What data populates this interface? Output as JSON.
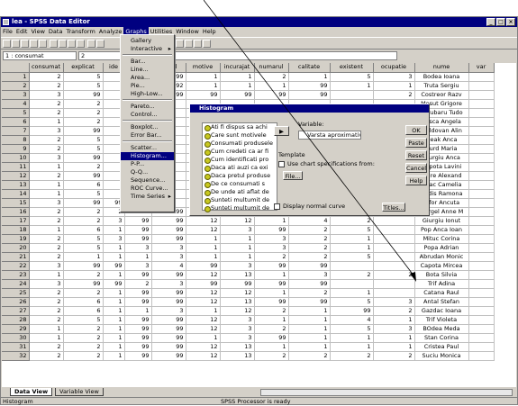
{
  "title": "lea - SPSS Data Editor",
  "window_buttons": [
    "_",
    "□",
    "×"
  ],
  "menus": [
    "File",
    "Edit",
    "View",
    "Data",
    "Transform",
    "Analyze",
    "Graphs",
    "Utilities",
    "Window",
    "Help"
  ],
  "active_menu": "Graphs",
  "cell_ref": "1 : consumat",
  "cell_value": "2",
  "columns": [
    "consumat",
    "explicat",
    "ide",
    "",
    "pretul",
    "motive",
    "incurajat",
    "numarul",
    "calitate",
    "existent",
    "ocupatie",
    "nume",
    "var"
  ],
  "rows": [
    [
      "2",
      "5",
      "",
      "",
      "99",
      "1",
      "1",
      "2",
      "1",
      "5",
      "3",
      "Bodea Ioana"
    ],
    [
      "2",
      "5",
      "",
      "",
      "992",
      "1",
      "1",
      "1",
      "99",
      "1",
      "1",
      "Truta Sergiu"
    ],
    [
      "3",
      "99",
      "",
      "",
      "99",
      "99",
      "99",
      "99",
      "99",
      "",
      "2",
      "Costreor Razv"
    ],
    [
      "2",
      "2",
      "",
      "",
      "",
      "",
      "",
      "",
      "",
      "",
      "",
      "Mosut Grigore"
    ],
    [
      "2",
      "2",
      "",
      "",
      "",
      "",
      "",
      "",
      "",
      "",
      "",
      "Surubaru Tudo"
    ],
    [
      "1",
      "2",
      "",
      "",
      "",
      "",
      "",
      "",
      "",
      "",
      "",
      "Rosca Angela"
    ],
    [
      "3",
      "99",
      "",
      "",
      "",
      "",
      "",
      "",
      "",
      "",
      "",
      "Moldovan Alin"
    ],
    [
      "2",
      "5",
      "",
      "",
      "",
      "",
      "",
      "",
      "",
      "",
      "",
      "Deak Anca"
    ],
    [
      "2",
      "5",
      "",
      "",
      "",
      "",
      "",
      "",
      "",
      "",
      "",
      "Surd Maria"
    ],
    [
      "3",
      "99",
      "",
      "",
      "",
      "",
      "",
      "",
      "",
      "",
      "",
      "Giurgiu Anca"
    ],
    [
      "1",
      "2",
      "",
      "",
      "",
      "",
      "",
      "",
      "",
      "",
      "",
      "Capota Lavini"
    ],
    [
      "2",
      "99",
      "",
      "",
      "",
      "",
      "",
      "",
      "",
      "",
      "",
      "Indre Alexand"
    ],
    [
      "1",
      "6",
      "",
      "",
      "",
      "",
      "",
      "",
      "",
      "",
      "",
      "Deac Camelia"
    ],
    [
      "1",
      "5",
      "",
      "",
      "",
      "",
      "",
      "",
      "",
      "",
      "",
      "Hodis Ramona"
    ],
    [
      "3",
      "99",
      "99",
      "3",
      "",
      "",
      "",
      "",
      "",
      "",
      "",
      "Cifor Ancuta"
    ],
    [
      "2",
      "2",
      "2",
      "99",
      "99",
      "1",
      "2",
      "1",
      "6",
      "3",
      "",
      "Mergel Anne M"
    ],
    [
      "2",
      "2",
      "3",
      "99",
      "99",
      "12",
      "12",
      "1",
      "4",
      "2",
      "",
      "Giurgiu Ionut"
    ],
    [
      "1",
      "6",
      "1",
      "99",
      "99",
      "12",
      "3",
      "99",
      "2",
      "5",
      "",
      "Pop Anca Ioan"
    ],
    [
      "2",
      "5",
      "3",
      "99",
      "99",
      "1",
      "1",
      "3",
      "2",
      "1",
      "",
      "Mituc Corina"
    ],
    [
      "2",
      "5",
      "1",
      "3",
      "3",
      "1",
      "1",
      "3",
      "2",
      "1",
      "",
      "Popa Adrian"
    ],
    [
      "2",
      "1",
      "1",
      "1",
      "3",
      "1",
      "1",
      "2",
      "2",
      "5",
      "",
      "Abrudan Monic"
    ],
    [
      "3",
      "99",
      "99",
      "3",
      "4",
      "99",
      "3",
      "99",
      "99",
      "",
      "",
      "Capota Mircea"
    ],
    [
      "1",
      "2",
      "1",
      "99",
      "99",
      "12",
      "13",
      "1",
      "3",
      "2",
      "2",
      "Bota Silvia"
    ],
    [
      "3",
      "99",
      "99",
      "2",
      "3",
      "99",
      "99",
      "99",
      "99",
      "",
      "",
      "Trif Adina"
    ],
    [
      "2",
      "2",
      "1",
      "99",
      "99",
      "12",
      "12",
      "1",
      "2",
      "1",
      "",
      "Catana Raul"
    ],
    [
      "2",
      "6",
      "1",
      "99",
      "99",
      "12",
      "13",
      "99",
      "99",
      "5",
      "3",
      "Antal Stefan"
    ],
    [
      "2",
      "6",
      "1",
      "1",
      "3",
      "1",
      "12",
      "2",
      "1",
      "99",
      "2",
      "Gazdac Ioana"
    ],
    [
      "2",
      "5",
      "1",
      "99",
      "99",
      "12",
      "3",
      "1",
      "1",
      "4",
      "1",
      "Trif Violeta"
    ],
    [
      "1",
      "2",
      "1",
      "99",
      "99",
      "12",
      "3",
      "2",
      "1",
      "5",
      "3",
      "BOdea Meda"
    ],
    [
      "1",
      "2",
      "1",
      "99",
      "99",
      "1",
      "3",
      "99",
      "1",
      "1",
      "1",
      "Stan Corina"
    ],
    [
      "2",
      "2",
      "1",
      "99",
      "99",
      "12",
      "13",
      "1",
      "1",
      "1",
      "1",
      "Cristea Paul"
    ],
    [
      "2",
      "2",
      "1",
      "99",
      "99",
      "12",
      "13",
      "2",
      "2",
      "2",
      "2",
      "Suciu Monica"
    ]
  ],
  "graphs_menu": {
    "items": [
      {
        "label": "Gallery",
        "sub": false
      },
      {
        "label": "Interactive",
        "sub": true
      },
      {
        "sep": true
      },
      {
        "label": "Bar...",
        "sub": false
      },
      {
        "label": "Line...",
        "sub": false
      },
      {
        "label": "Area...",
        "sub": false
      },
      {
        "label": "Pie...",
        "sub": false
      },
      {
        "label": "High-Low...",
        "sub": false
      },
      {
        "sep": true
      },
      {
        "label": "Pareto...",
        "sub": false
      },
      {
        "label": "Control...",
        "sub": false
      },
      {
        "sep": true
      },
      {
        "label": "Boxplot...",
        "sub": false
      },
      {
        "label": "Error Bar...",
        "sub": false
      },
      {
        "sep": true
      },
      {
        "label": "Scatter...",
        "sub": false
      },
      {
        "label": "Histogram...",
        "sub": false,
        "highlighted": true
      },
      {
        "label": "P-P...",
        "sub": false
      },
      {
        "label": "Q-Q...",
        "sub": false
      },
      {
        "label": "Sequence...",
        "sub": false
      },
      {
        "label": "ROC Curve...",
        "sub": false
      },
      {
        "label": "Time Series",
        "sub": true
      }
    ]
  },
  "dialog": {
    "title": "Histogram",
    "variables": [
      "Ati fi dispus sa achi",
      "Care sunt motivele",
      "Consumati produsele",
      "Cum credeti ca ar fi",
      "Cum identificati pro",
      "Daca ati auzi ca exi",
      "Daca pretul produse",
      "De ce consumati s",
      "De unde ati aflat de",
      "Sunteti multumit de",
      "Sunteti multumit de"
    ],
    "variable_label": "Variable:",
    "variable_value": "Varsta aproximativa [v",
    "template_label": "Template",
    "template_checkbox": "Use chart specifications from:",
    "file_btn": "File...",
    "normal_curve": "Display normal curve",
    "titles_btn": "Titles...",
    "buttons": [
      "OK",
      "Paste",
      "Reset",
      "Cancel",
      "Help"
    ]
  },
  "tabs": {
    "data_view": "Data View",
    "variable_view": "Variable View"
  },
  "status": {
    "left": "Histogram",
    "center": "SPSS Processor is ready"
  }
}
